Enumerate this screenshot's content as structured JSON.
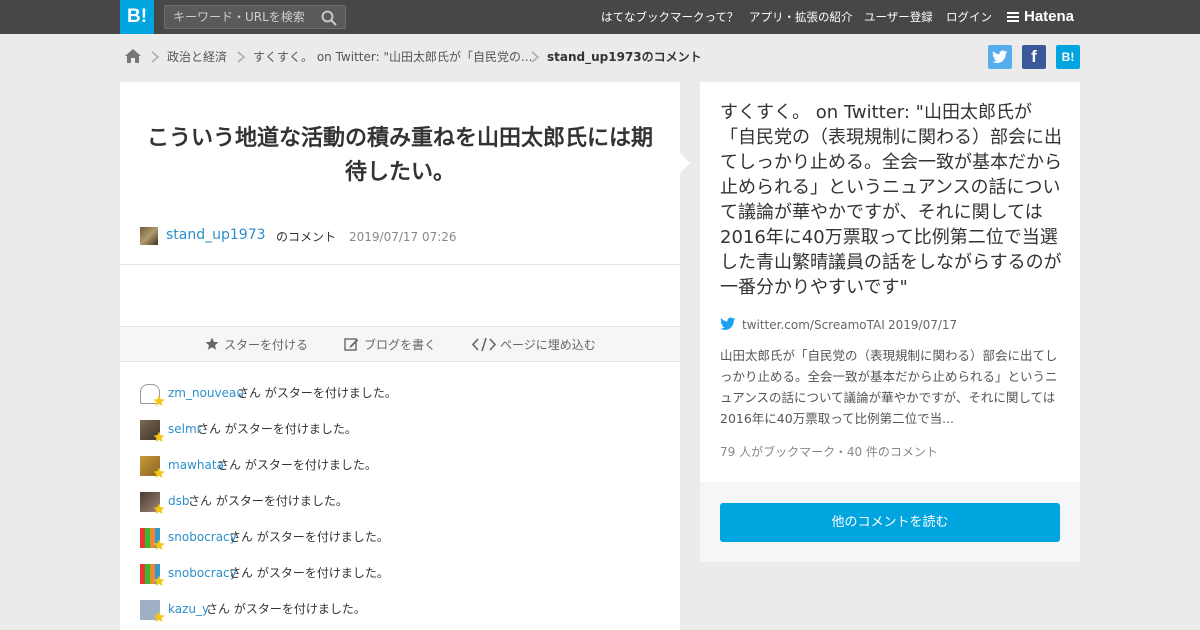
{
  "header": {
    "logo": "B!",
    "search_placeholder": "キーワード・URLを検索",
    "nav": [
      "はてなブックマークって？",
      "アプリ・拡張の紹介",
      "ユーザー登録",
      "ログイン"
    ],
    "brand": "Hatena",
    "accent_color": "#00a4de"
  },
  "breadcrumb": {
    "items": [
      "政治と経済",
      "すくすく。 on Twitter: \"山田太郎氏が「自民党の...",
      "stand_up1973のコメント"
    ]
  },
  "share": {
    "facebook_label": "f",
    "hatena_label": "B!"
  },
  "comment": {
    "text": "こういう地道な活動の積み重ねを山田太郎氏には期待したい。",
    "user": "stand_up1973",
    "user_suffix": "のコメント",
    "date": "2019/07/17 07:26"
  },
  "actions": {
    "star": "スターを付ける",
    "blog": "ブログを書く",
    "embed": "ページに埋め込む"
  },
  "stars": {
    "suffix": "さん がスターを付けました。",
    "users": [
      "zm_nouveau",
      "selmr",
      "mawhata",
      "dsb",
      "snobocracy",
      "snobocracy",
      "kazu_y"
    ]
  },
  "entry": {
    "title": "すくすく。 on Twitter: \"山田太郎氏が「自民党の（表現規制に関わる）部会に出てしっかり止める。全会一致が基本だから止められる」というニュアンスの話について議論が華やかですが、それに関しては2016年に40万票取って比例第二位で当選した青山繁晴議員の話をしながらするのが一番分かりやすいです\"",
    "domain": "twitter.com/ScreamoTAI",
    "date": "2019/07/17",
    "summary": "山田太郎氏が「自民党の（表現規制に関わる）部会に出てしっかり止める。全会一致が基本だから止められる」というニュアンスの話について議論が華やかですが、それに関しては2016年に40万票取って比例第二位で当...",
    "counts": "79 人がブックマーク・40 件のコメント",
    "more_button": "他のコメントを読む"
  }
}
